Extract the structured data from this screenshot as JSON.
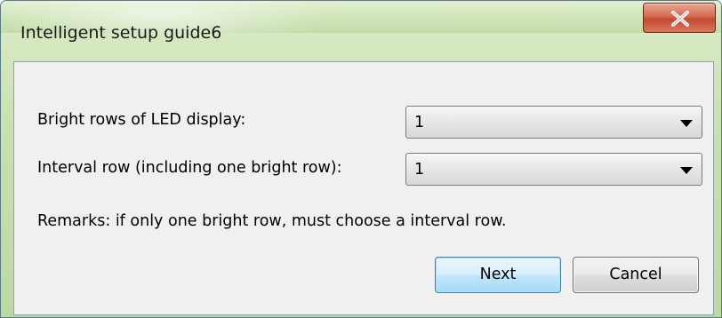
{
  "window": {
    "title": "Intelligent setup guide6"
  },
  "form": {
    "bright_rows": {
      "label": "Bright rows of LED display:",
      "value": "1"
    },
    "interval_row": {
      "label": "Interval row (including one bright row):",
      "value": "1"
    },
    "remarks": "Remarks: if only one bright row, must choose a interval row."
  },
  "buttons": {
    "next": "Next",
    "cancel": "Cancel"
  },
  "icons": {
    "close": "close-icon",
    "dropdown": "chevron-down-icon"
  },
  "colors": {
    "title_bar": "#c9e0b0",
    "close_button": "#c9503a",
    "default_button_border": "#3c7fb1",
    "client_background": "#f0f0f0"
  }
}
